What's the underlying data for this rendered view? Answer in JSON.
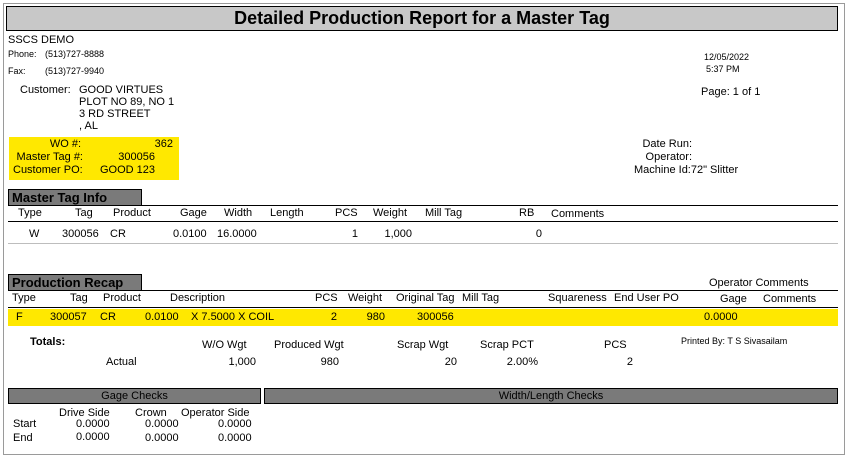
{
  "report": {
    "title": "Detailed Production Report for a Master Tag",
    "company": "SSCS DEMO",
    "phone_label": "Phone:",
    "phone": "(513)727-8888",
    "fax_label": "Fax:",
    "fax": "(513)727-9940",
    "date": "12/05/2022",
    "time": "5:37 PM",
    "page": "Page: 1 of 1"
  },
  "customer": {
    "label": "Customer:",
    "lines": [
      "GOOD VIRTUES",
      "PLOT NO 89, NO 1",
      "3 RD STREET",
      ", AL"
    ]
  },
  "wo": {
    "wo_label": "WO #:",
    "wo_value": "362",
    "master_tag_label": "Master Tag #:",
    "master_tag_value": "300056",
    "customer_po_label": "Customer PO:",
    "customer_po_value": "GOOD 123"
  },
  "run": {
    "date_run_label": "Date Run:",
    "operator_label": "Operator:",
    "machine_label": "Machine Id:72\" Slitter"
  },
  "master_tag_info": {
    "title": "Master Tag Info",
    "headers": [
      "Type",
      "Tag",
      "Product",
      "Gage",
      "Width",
      "Length",
      "PCS",
      "Weight",
      "Mill Tag",
      "RB",
      "Comments"
    ],
    "row": {
      "type": "W",
      "tag": "300056",
      "product": "CR",
      "gage": "0.0100",
      "width": "16.0000",
      "length": "",
      "pcs": "1",
      "weight": "1,000",
      "mill_tag": "",
      "rb": "0",
      "comments": ""
    }
  },
  "production_recap": {
    "title": "Production Recap",
    "operator_comments_label": "Operator Comments",
    "headers": [
      "Type",
      "Tag",
      "Product",
      "Description",
      "PCS",
      "Weight",
      "Original Tag",
      "Mill Tag",
      "Squareness",
      "End User PO",
      "Gage",
      "Comments"
    ],
    "row": {
      "type": "F",
      "tag": "300057",
      "product": "CR",
      "gage_desc": "0.0100",
      "desc": "X 7.5000  X COIL",
      "pcs": "2",
      "weight": "980",
      "original_tag": "300056",
      "gage": "0.0000"
    }
  },
  "totals": {
    "label": "Totals:",
    "headers": [
      "W/O Wgt",
      "Produced Wgt",
      "Scrap Wgt",
      "Scrap PCT",
      "PCS"
    ],
    "row_label": "Actual",
    "values": [
      "1,000",
      "980",
      "20",
      "2.00%",
      "2"
    ],
    "printed_by": "Printed By:  T S Sivasailam"
  },
  "gage_checks": {
    "title": "Gage Checks",
    "headers": [
      "Drive Side",
      "Crown",
      "Operator Side"
    ],
    "rows": [
      {
        "label": "Start",
        "values": [
          "0.0000",
          "0.0000",
          "0.0000"
        ]
      },
      {
        "label": "End",
        "values": [
          "0.0000",
          "0.0000",
          "0.0000"
        ]
      }
    ]
  },
  "width_length_checks": {
    "title": "Width/Length Checks"
  }
}
